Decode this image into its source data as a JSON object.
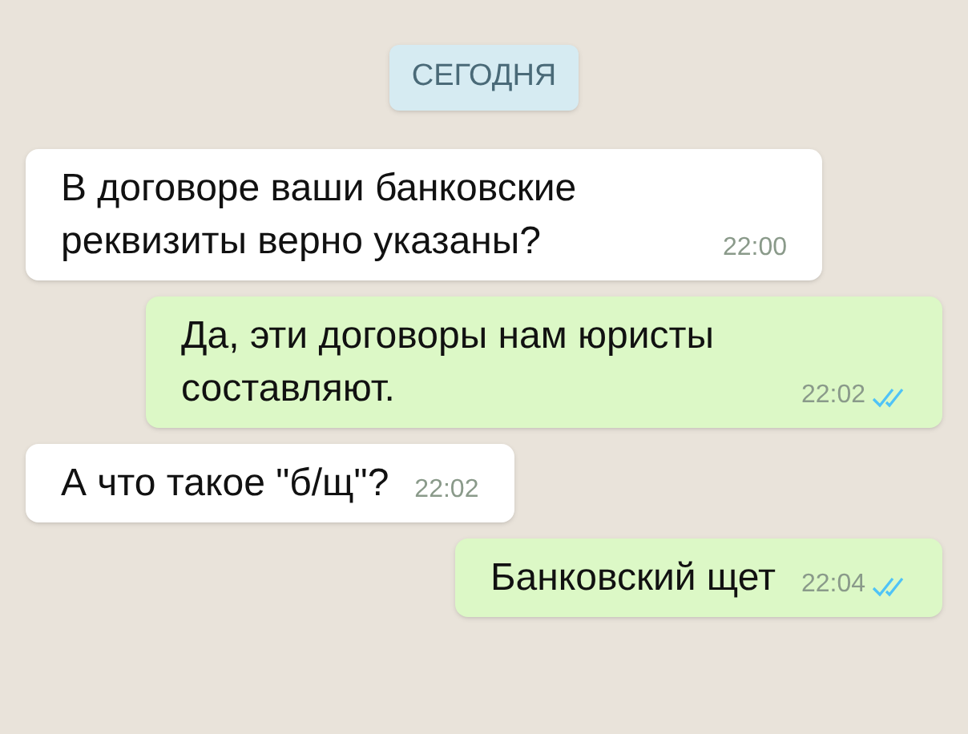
{
  "date_chip": "СЕГОДНЯ",
  "messages": [
    {
      "kind": "incoming",
      "text": "В договоре ваши банковские реквизиты верно указаны?",
      "time": "22:00"
    },
    {
      "kind": "outgoing",
      "text": "Да, эти договоры нам юристы составляют.",
      "time": "22:02",
      "read": true
    },
    {
      "kind": "incoming",
      "text": "А что такое \"б/щ\"?",
      "time": "22:02"
    },
    {
      "kind": "outgoing",
      "text": "Банковский щет",
      "time": "22:04",
      "read": true
    }
  ]
}
